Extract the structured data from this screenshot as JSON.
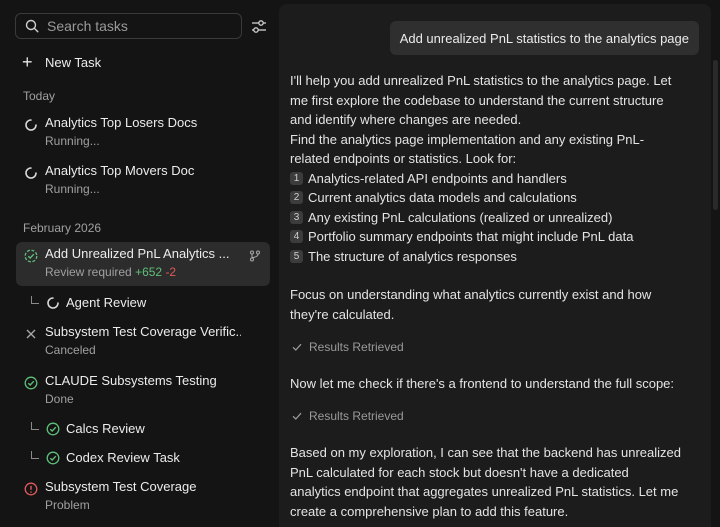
{
  "search": {
    "placeholder": "Search tasks"
  },
  "sidebar": {
    "new_task_label": "New Task",
    "sections": {
      "today": "Today",
      "february": "February 2026"
    },
    "tasks_today": [
      {
        "title": "Analytics Top Losers Docs",
        "status": "Running..."
      },
      {
        "title": "Analytics Top Movers Doc",
        "status": "Running..."
      }
    ],
    "active_task": {
      "title": "Add Unrealized PnL Analytics ...",
      "status": "Review required",
      "additions": "+652",
      "deletions": "-2"
    },
    "agent_review": "Agent Review",
    "task_coverage": {
      "title": "Subsystem Test Coverage Verific...",
      "status": "Canceled"
    },
    "task_claude": {
      "title": "CLAUDE Subsystems Testing",
      "status": "Done"
    },
    "calcs_review": "Calcs Review",
    "codex_review": "Codex Review Task",
    "task_problem": {
      "title": "Subsystem Test Coverage",
      "status": "Problem"
    }
  },
  "chat": {
    "user_message": "Add unrealized PnL statistics to the analytics page",
    "intro_lines": [
      "I'll help you add unrealized PnL statistics to the analytics page. Let",
      "me first explore the codebase to understand the current structure",
      "and identify where changes are needed.",
      "Find the analytics page implementation and any existing PnL-",
      "related endpoints or statistics. Look for:"
    ],
    "list_items": [
      {
        "n": "1",
        "text": "Analytics-related API endpoints and handlers"
      },
      {
        "n": "2",
        "text": "Current analytics data models and calculations"
      },
      {
        "n": "3",
        "text": "Any existing PnL calculations (realized or unrealized)"
      },
      {
        "n": "4",
        "text": "Portfolio summary endpoints that might include PnL data"
      },
      {
        "n": "5",
        "text": "The structure of analytics responses"
      }
    ],
    "focus_lines": [
      "Focus on understanding what analytics currently exist and how",
      "they're calculated."
    ],
    "results_retrieved_1": "Results Retrieved",
    "frontend_check": "Now let me check if there's a frontend to understand the full scope:",
    "results_retrieved_2": "Results Retrieved",
    "conclusion_lines": [
      "Based on my exploration, I can see that the backend has unrealized",
      "PnL calculated for each stock but doesn't have a dedicated",
      "analytics endpoint that aggregates unrealized PnL statistics. Let me",
      "create a comprehensive plan to add this feature."
    ]
  },
  "colors": {
    "success": "#5fbf7a",
    "error": "#e05a5a",
    "accent_bg": "#2c2c2c"
  }
}
